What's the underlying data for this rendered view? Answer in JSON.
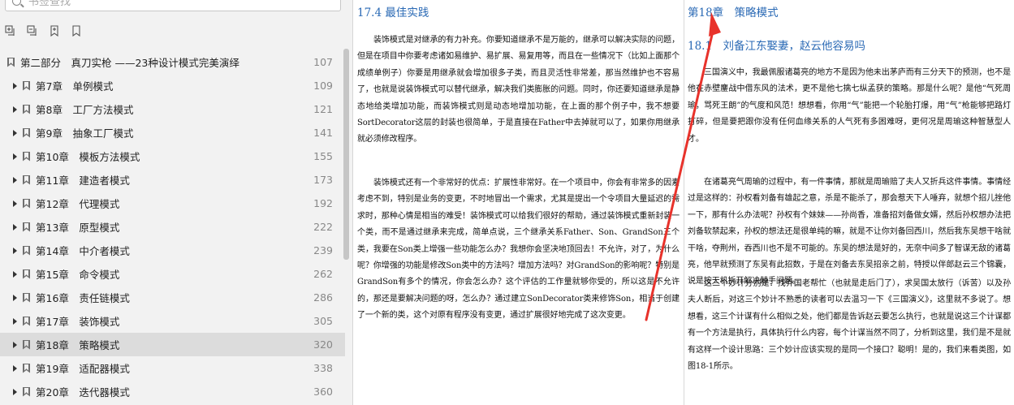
{
  "sidebar": {
    "search_placeholder": "书签查找",
    "toolbar": [
      "expand-all-icon",
      "collapse-all-icon",
      "add-bookmark-icon",
      "bookmark-icon"
    ],
    "toc": [
      {
        "title": "第二部分　真刀实枪 ——23种设计模式完美演绎",
        "page": "107",
        "level": 0
      },
      {
        "title": "第7章　单例模式",
        "page": "109",
        "level": 1
      },
      {
        "title": "第8章　工厂方法模式",
        "page": "121",
        "level": 1
      },
      {
        "title": "第9章　抽象工厂模式",
        "page": "141",
        "level": 1
      },
      {
        "title": "第10章　模板方法模式",
        "page": "155",
        "level": 1
      },
      {
        "title": "第11章　建造者模式",
        "page": "173",
        "level": 1
      },
      {
        "title": "第12章　代理模式",
        "page": "192",
        "level": 1
      },
      {
        "title": "第13章　原型模式",
        "page": "222",
        "level": 1
      },
      {
        "title": "第14章　中介者模式",
        "page": "239",
        "level": 1
      },
      {
        "title": "第15章　命令模式",
        "page": "262",
        "level": 1
      },
      {
        "title": "第16章　责任链模式",
        "page": "286",
        "level": 1
      },
      {
        "title": "第17章　装饰模式",
        "page": "305",
        "level": 1
      },
      {
        "title": "第18章　策略模式",
        "page": "320",
        "level": 1,
        "selected": true
      },
      {
        "title": "第19章　适配器模式",
        "page": "338",
        "level": 1
      },
      {
        "title": "第20章　迭代器模式",
        "page": "360",
        "level": 1
      }
    ]
  },
  "reader": {
    "left": {
      "heading": "17.4 最佳实践",
      "paragraphs": [
        "装饰模式是对继承的有力补充。你要知道继承不是万能的，继承可以解决实际的问题，但是在项目中你要考虑诸如易维护、易扩展、易复用等，而且在一些情况下（比如上面那个成绩单例子）你要是用继承就会增加很多子类，而且灵活性非常差，那当然维护也不容易了，也就是说装饰模式可以替代继承，解决我们类膨胀的问题。同时，你还要知道继承是静态地给类增加功能，而装饰模式则是动态地增加功能，在上面的那个例子中，我不想要SortDecorator这层的封装也很简单，于是直接在Father中去掉就可以了，如果你用继承就必须修改程序。",
        "装饰模式还有一个非常好的优点：扩展性非常好。在一个项目中，你会有非常多的因素考虑不到，特别是业务的变更，不时地冒出一个需求，尤其是提出一个令项目大量延迟的需求时，那种心情是相当的难受！装饰模式可以给我们很好的帮助，通过装饰模式重新封装一个类，而不是通过继承来完成，简单点说，三个继承关系Father、Son、GrandSon三个类，我要在Son类上增强一些功能怎么办？我想你会坚决地顶回去！不允许，对了，为什么呢？你增强的功能是修改Son类中的方法吗？增加方法吗？对GrandSon的影响呢？特别是GrandSon有多个的情况，你会怎么办？这个评估的工作量就够你受的，所以这是不允许的，那还是要解决问题的呀，怎么办？通过建立SonDecorator类来修饰Son，相当于创建了一个新的类，这个对原有程序没有变更，通过扩展很好地完成了这次变更。"
      ]
    },
    "right": {
      "chapter": "第18章　策略模式",
      "section": "18.1　刘备江东娶妻，赵云他容易吗",
      "paragraphs": [
        "三国演义中，我最佩服诸葛亮的地方不是因为他未出茅庐而有三分天下的预测，也不是他在赤壁鏖战中借东风的法术，更不是他七擒七纵孟获的策略。那是什么呢？是他“气死周瑜，骂死王朗”的气度和风范！想想看，你用“气”能把一个轮胎打爆，用“气”枪能够把路灯打碎，但是要把跟你没有任何血缘关系的人气死有多困难呀，更何况是周瑜这种智慧型人才。",
        "在诸葛亮气周瑜的过程中，有一件事情，那就是周瑜赔了夫人又折兵这件事情。事情经过是这样的：孙权看刘备有雄起之意，杀是不能杀了，那会惹天下人唾弃，就想个招儿挫他一下，那有什么办法呢？孙权有个妹妹——孙尚香，准备招刘备做女婿，然后孙权想办法把刘备软禁起来，孙权的想法还是很单纯的嘛，就是不让你刘备回西川，然后我东吴想干啥就干啥，夺荆州，吞西川也不是不可能的。东吴的想法是好的，无奈中间多了智谋无敌的诸葛亮，他早就预测了东吴有此招数，于是在刘备去东吴招亲之前，特授以伴郎赵云三个锦囊，说是按天机拆开解决棘手问题。",
        "这三个妙计分别是：找乔国老帮忙（也就是走后门了），求吴国太放行（诉苦）以及孙夫人断后，对这三个妙计不熟悉的读者可以去温习一下《三国演义》，这里就不多说了。想想看，这三个计谋有什么相似之处，他们都是告诉赵云要怎么执行，也就是说这三个计谋都有一个方法是执行，具体执行什么内容，每个计谋当然不同了，分析到这里，我们是不是就有这样一个设计思路：三个妙计应该实现的是同一个接口？聪明！是的，我们来看类图，如图18-1所示。"
      ]
    }
  },
  "colors": {
    "heading": "#2b6ab5",
    "annotation_arrow": "#e8322b",
    "selected_row": "#dcdcdc"
  }
}
